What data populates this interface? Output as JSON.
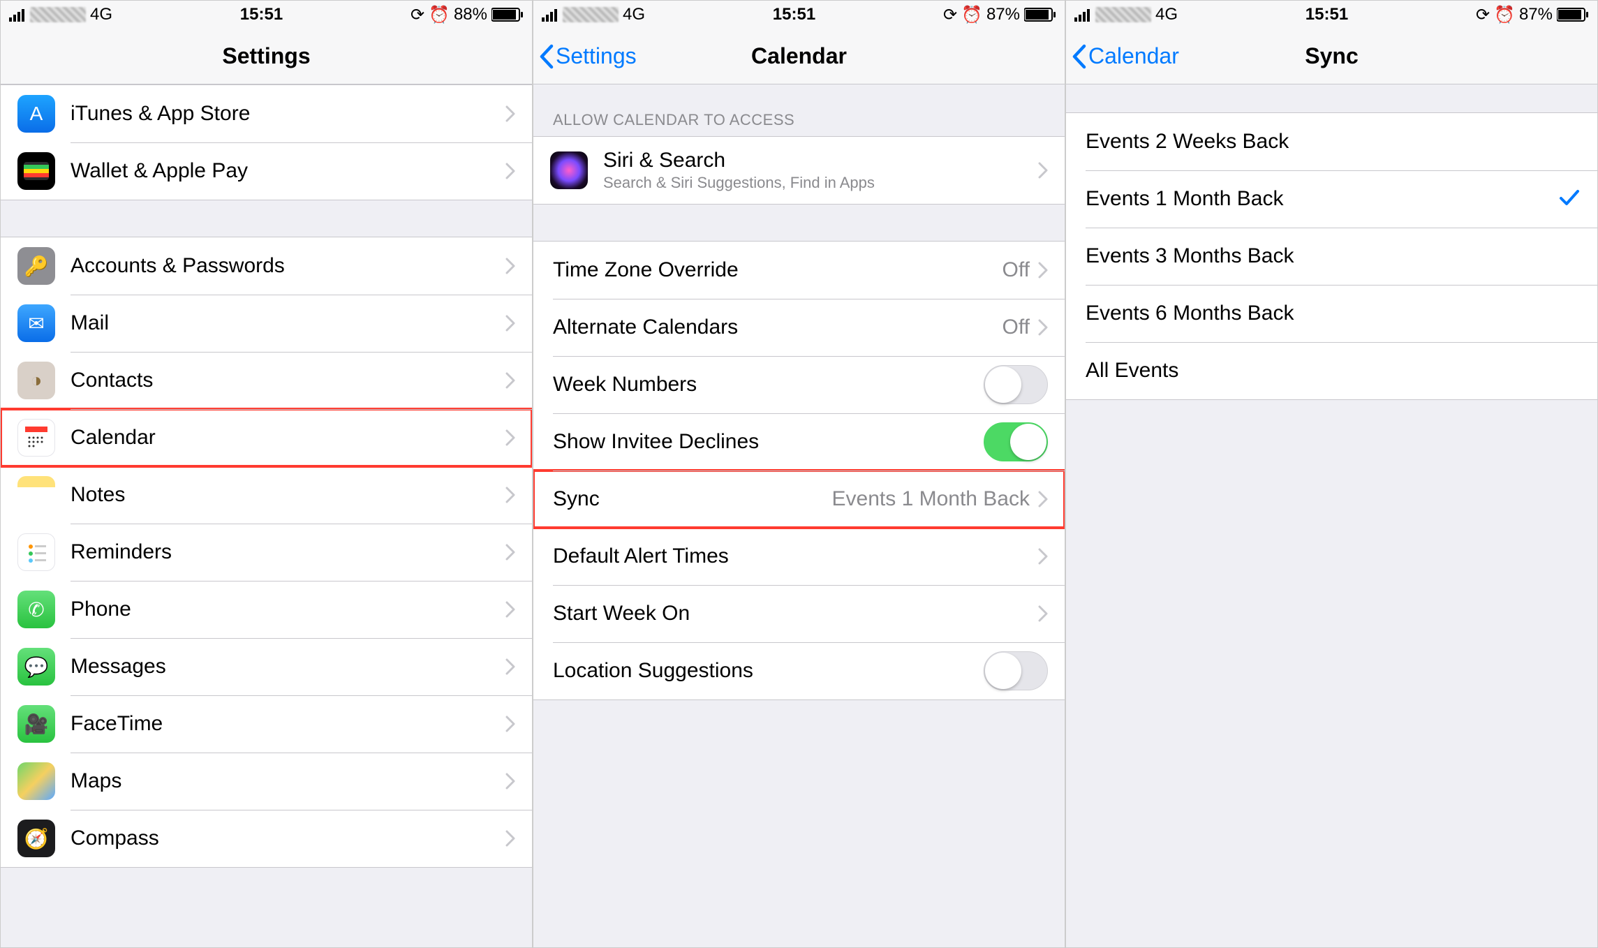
{
  "statusBars": {
    "pane1": {
      "network": "4G",
      "time": "15:51",
      "battery": "88%"
    },
    "pane2": {
      "network": "4G",
      "time": "15:51",
      "battery": "87%"
    },
    "pane3": {
      "network": "4G",
      "time": "15:51",
      "battery": "87%"
    }
  },
  "pane1": {
    "title": "Settings",
    "group1": [
      {
        "label": "iTunes & App Store",
        "icon": "appstore"
      },
      {
        "label": "Wallet & Apple Pay",
        "icon": "wallet"
      }
    ],
    "group2": [
      {
        "label": "Accounts & Passwords",
        "icon": "accounts"
      },
      {
        "label": "Mail",
        "icon": "mail"
      },
      {
        "label": "Contacts",
        "icon": "contacts"
      },
      {
        "label": "Calendar",
        "icon": "calendar",
        "highlight": true
      },
      {
        "label": "Notes",
        "icon": "notes"
      },
      {
        "label": "Reminders",
        "icon": "reminders"
      },
      {
        "label": "Phone",
        "icon": "phone"
      },
      {
        "label": "Messages",
        "icon": "messages"
      },
      {
        "label": "FaceTime",
        "icon": "facetime"
      },
      {
        "label": "Maps",
        "icon": "maps"
      },
      {
        "label": "Compass",
        "icon": "compass"
      }
    ]
  },
  "pane2": {
    "back": "Settings",
    "title": "Calendar",
    "sectionHeader": "Allow Calendar to Access",
    "siri": {
      "label": "Siri & Search",
      "sub": "Search & Siri Suggestions, Find in Apps"
    },
    "rows": {
      "tz": {
        "label": "Time Zone Override",
        "value": "Off"
      },
      "alt": {
        "label": "Alternate Calendars",
        "value": "Off"
      },
      "week": {
        "label": "Week Numbers",
        "toggle": false
      },
      "invite": {
        "label": "Show Invitee Declines",
        "toggle": true
      },
      "sync": {
        "label": "Sync",
        "value": "Events 1 Month Back",
        "highlight": true
      },
      "alert": {
        "label": "Default Alert Times"
      },
      "start": {
        "label": "Start Week On"
      },
      "loc": {
        "label": "Location Suggestions",
        "toggle": false
      }
    }
  },
  "pane3": {
    "back": "Calendar",
    "title": "Sync",
    "options": [
      {
        "label": "Events 2 Weeks Back",
        "checked": false
      },
      {
        "label": "Events 1 Month Back",
        "checked": true
      },
      {
        "label": "Events 3 Months Back",
        "checked": false
      },
      {
        "label": "Events 6 Months Back",
        "checked": false
      },
      {
        "label": "All Events",
        "checked": false
      }
    ]
  }
}
